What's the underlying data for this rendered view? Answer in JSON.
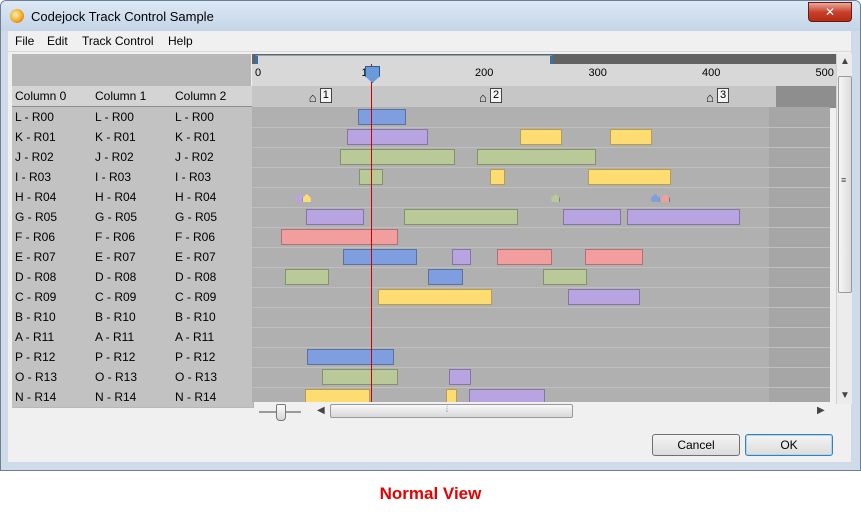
{
  "window": {
    "title": "Codejock Track Control Sample",
    "close_label": "✕"
  },
  "menu": [
    "File",
    "Edit",
    "Track Control",
    "Help"
  ],
  "grid": {
    "columns": [
      "Column 0",
      "Column 1",
      "Column 2"
    ],
    "rows": [
      [
        "L - R00",
        "L - R00",
        "L - R00"
      ],
      [
        "K - R01",
        "K - R01",
        "K - R01"
      ],
      [
        "J - R02",
        "J - R02",
        "J - R02"
      ],
      [
        "I - R03",
        "I - R03",
        "I - R03"
      ],
      [
        "H - R04",
        "H - R04",
        "H - R04"
      ],
      [
        "G - R05",
        "G - R05",
        "G - R05"
      ],
      [
        "F - R06",
        "F - R06",
        "F - R06"
      ],
      [
        "E - R07",
        "E - R07",
        "E - R07"
      ],
      [
        "D - R08",
        "D - R08",
        "D - R08"
      ],
      [
        "C - R09",
        "C - R09",
        "C - R09"
      ],
      [
        "B - R10",
        "B - R10",
        "B - R10"
      ],
      [
        "A - R11",
        "A - R11",
        "A - R11"
      ],
      [
        "P - R12",
        "P - R12",
        "P - R12"
      ],
      [
        "O - R13",
        "O - R13",
        "O - R13"
      ],
      [
        "N - R14",
        "N - R14",
        "N - R14"
      ]
    ]
  },
  "timeline": {
    "ruler_labels": [
      "0",
      "100",
      "200",
      "300",
      "400",
      "500"
    ],
    "ruler_values": [
      0,
      100,
      200,
      300,
      400,
      500
    ],
    "markers": [
      {
        "label": "1",
        "value": 50
      },
      {
        "label": "2",
        "value": 200
      },
      {
        "label": "3",
        "value": 400
      }
    ],
    "playhead_value": 100,
    "colors": {
      "blue": "#7f9ee0",
      "purple": "#b7a4e0",
      "yellow": "#fddc71",
      "green": "#b9ca98",
      "red": "#f29e9e"
    },
    "blocks": [
      {
        "row": 0,
        "start": 88,
        "end": 130,
        "color": "blue"
      },
      {
        "row": 1,
        "start": 78,
        "end": 150,
        "color": "purple"
      },
      {
        "row": 1,
        "start": 231,
        "end": 268,
        "color": "yellow"
      },
      {
        "row": 1,
        "start": 310,
        "end": 347,
        "color": "yellow"
      },
      {
        "row": 2,
        "start": 72,
        "end": 174,
        "color": "green"
      },
      {
        "row": 2,
        "start": 193,
        "end": 298,
        "color": "green"
      },
      {
        "row": 3,
        "start": 89,
        "end": 110,
        "color": "green"
      },
      {
        "row": 3,
        "start": 204,
        "end": 218,
        "color": "yellow"
      },
      {
        "row": 3,
        "start": 291,
        "end": 364,
        "color": "yellow"
      },
      {
        "row": 5,
        "start": 42,
        "end": 93,
        "color": "purple"
      },
      {
        "row": 5,
        "start": 129,
        "end": 229,
        "color": "green"
      },
      {
        "row": 5,
        "start": 269,
        "end": 320,
        "color": "purple"
      },
      {
        "row": 5,
        "start": 325,
        "end": 425,
        "color": "purple"
      },
      {
        "row": 6,
        "start": 20,
        "end": 123,
        "color": "red"
      },
      {
        "row": 7,
        "start": 75,
        "end": 140,
        "color": "blue"
      },
      {
        "row": 7,
        "start": 171,
        "end": 188,
        "color": "purple"
      },
      {
        "row": 7,
        "start": 211,
        "end": 259,
        "color": "red"
      },
      {
        "row": 7,
        "start": 288,
        "end": 339,
        "color": "red"
      },
      {
        "row": 8,
        "start": 24,
        "end": 63,
        "color": "green"
      },
      {
        "row": 8,
        "start": 150,
        "end": 181,
        "color": "blue"
      },
      {
        "row": 8,
        "start": 251,
        "end": 290,
        "color": "green"
      },
      {
        "row": 9,
        "start": 106,
        "end": 206,
        "color": "yellow"
      },
      {
        "row": 9,
        "start": 273,
        "end": 337,
        "color": "purple"
      },
      {
        "row": 12,
        "start": 43,
        "end": 120,
        "color": "blue"
      },
      {
        "row": 13,
        "start": 56,
        "end": 123,
        "color": "green"
      },
      {
        "row": 13,
        "start": 168,
        "end": 188,
        "color": "purple"
      },
      {
        "row": 14,
        "start": 41,
        "end": 99,
        "color": "yellow"
      },
      {
        "row": 14,
        "start": 166,
        "end": 175,
        "color": "yellow"
      },
      {
        "row": 14,
        "start": 186,
        "end": 253,
        "color": "purple"
      }
    ],
    "pins": [
      {
        "row": 4,
        "value": 37,
        "color": "purple"
      },
      {
        "row": 4,
        "value": 43,
        "color": "yellow"
      },
      {
        "row": 4,
        "value": 262,
        "color": "green"
      },
      {
        "row": 4,
        "value": 350,
        "color": "blue"
      },
      {
        "row": 4,
        "value": 359,
        "color": "red"
      }
    ]
  },
  "buttons": {
    "cancel": "Cancel",
    "ok": "OK"
  },
  "caption": "Normal View"
}
